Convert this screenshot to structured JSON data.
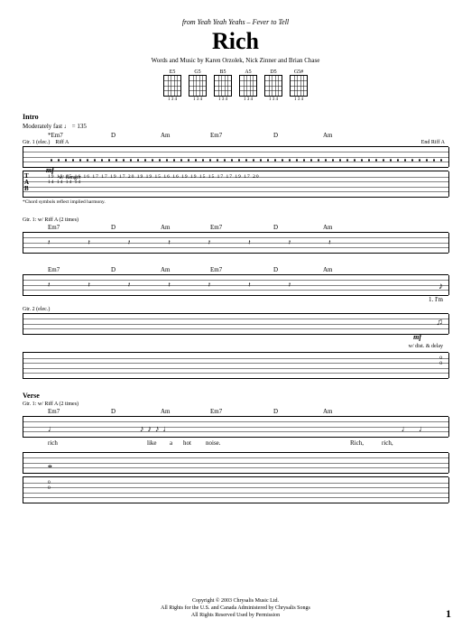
{
  "header": {
    "source_prefix": "from Yeah Yeah Yeahs – ",
    "source_album": "Fever to Tell",
    "title": "Rich",
    "credits": "Words and Music by Karen Orzolek, Nick Zinner and Brian Chase"
  },
  "chord_diagrams": [
    {
      "name": "E5",
      "fret": "1 3 4"
    },
    {
      "name": "G5",
      "fret": "1 3 4"
    },
    {
      "name": "B5",
      "fret": "1 3 4"
    },
    {
      "name": "A5",
      "fret": "1 3 4"
    },
    {
      "name": "D5",
      "fret": "1 3 4"
    },
    {
      "name": "G5#",
      "fret": "1 3 4"
    }
  ],
  "intro": {
    "label": "Intro",
    "tempo": "Moderately fast ♩ = 135",
    "gtr_label": "Gtr. 1 (elec.)",
    "riff_label": "Riff A",
    "end_riff": "End Riff A",
    "dynamic": "mf",
    "effect": "w/ flanger",
    "chords": [
      "*Em7",
      "D",
      "Am",
      "Em7",
      "D",
      "Am"
    ],
    "tab_line1": "19  19 15  16 16        17  17   19  17 20        19  19 15  16 16        19  19 15  15   17  17   19  17 20",
    "tab_line2": "14  14                                                  14  14",
    "footnote": "*Chord symbols reflect implied harmony."
  },
  "system2": {
    "gtr_label": "Gtr. 1: w/ Riff A (2 times)",
    "chords": [
      "Em7",
      "D",
      "Am",
      "Em7",
      "D",
      "Am"
    ]
  },
  "system3": {
    "chords": [
      "Em7",
      "D",
      "Am",
      "Em7",
      "D",
      "Am"
    ],
    "gtr2_label": "Gtr. 2 (elec.)",
    "dynamic": "mf",
    "effect": "w/ dist. & delay",
    "lyric": "1. I'm",
    "tab_end": "0\n0"
  },
  "verse": {
    "label": "Verse",
    "gtr_label": "Gtr. 1: w/ Riff A (2 times)",
    "chords": [
      "Em7",
      "D",
      "Am",
      "Em7",
      "D",
      "Am"
    ],
    "lyrics": [
      "rich",
      "",
      "like",
      "a",
      "hot",
      "noise.",
      "",
      "",
      "Rich,",
      "rich,"
    ]
  },
  "footer": {
    "line1": "Copyright © 2003 Chrysalis Music Ltd.",
    "line2": "All Rights for the U.S. and Canada Administered by Chrysalis Songs",
    "line3": "All Rights Reserved   Used by Permission"
  },
  "page": "1"
}
